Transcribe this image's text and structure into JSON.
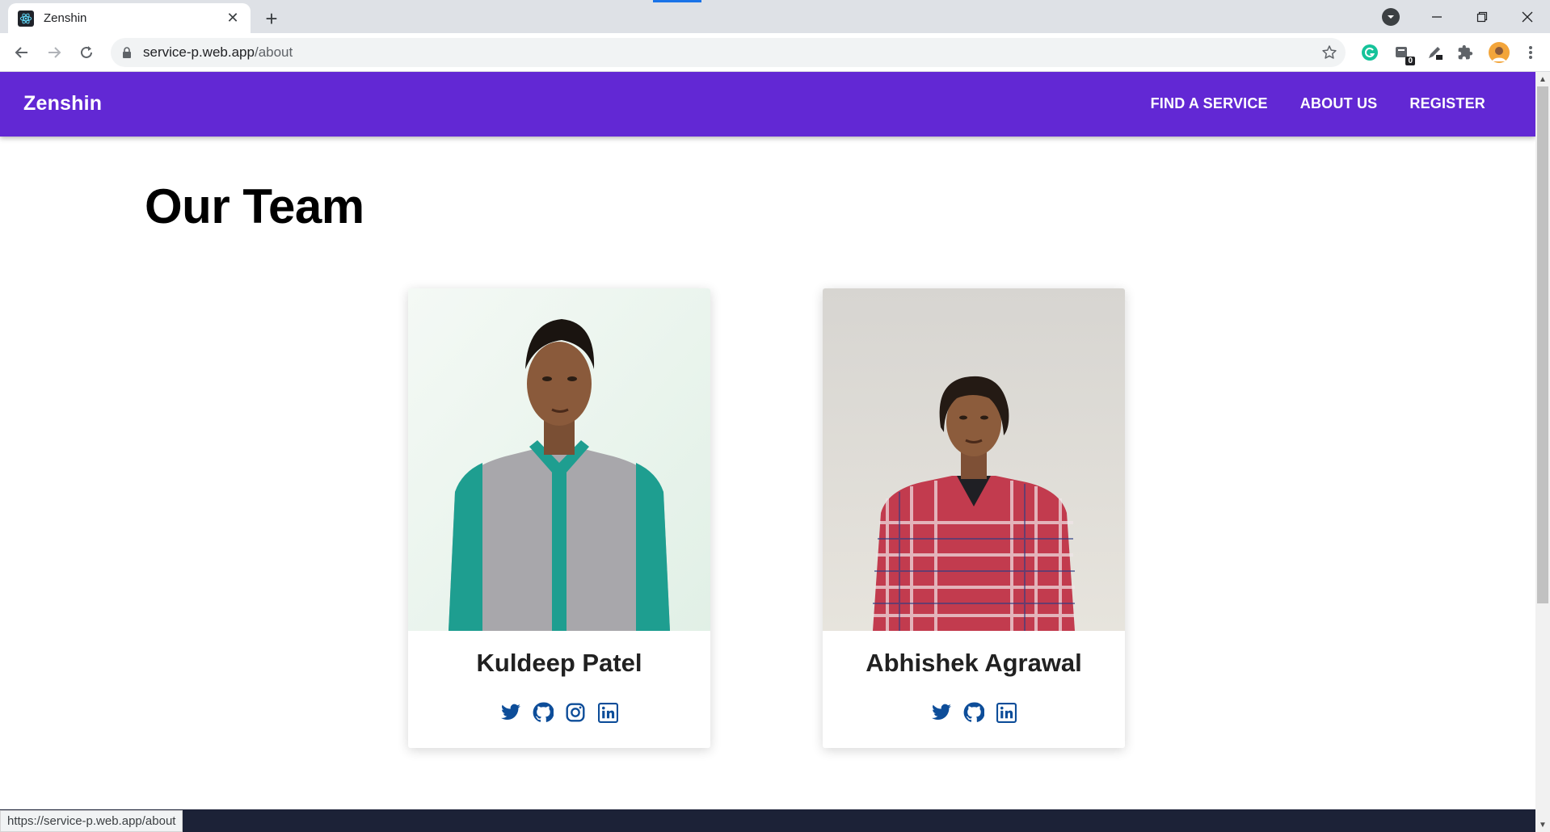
{
  "browser": {
    "tab_title": "Zenshin",
    "tab_close": "✕",
    "new_tab": "+",
    "url_host": "service-p.web.app",
    "url_path": "/about",
    "status_url": "https://service-p.web.app/about",
    "extension_badges": [
      "0"
    ]
  },
  "navbar": {
    "brand": "Zenshin",
    "links": [
      "FIND A SERVICE",
      "ABOUT US",
      "REGISTER"
    ]
  },
  "main": {
    "title": "Our Team",
    "members": [
      {
        "name": "Kuldeep Patel",
        "socials": [
          "twitter-icon",
          "github-icon",
          "instagram-icon",
          "linkedin-icon"
        ]
      },
      {
        "name": "Abhishek Agrawal",
        "socials": [
          "twitter-icon",
          "github-icon",
          "linkedin-icon"
        ]
      }
    ]
  },
  "colors": {
    "navbar": "#6228d4",
    "social_icon": "#0d4d99",
    "footer": "#1c2237"
  }
}
